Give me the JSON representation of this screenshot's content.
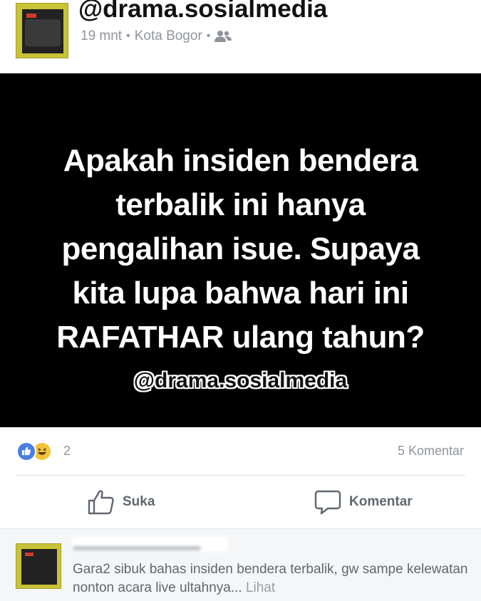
{
  "header": {
    "watermark": "@drama.sosialmedia",
    "time": "19 mnt",
    "location": "Kota Bogor",
    "separator": "•",
    "audience_icon": "friends-icon"
  },
  "post": {
    "lines": [
      "Apakah insiden bendera",
      "terbalik ini hanya",
      "pengalihan isue. Supaya",
      "kita lupa bahwa hari ini",
      "RAFATHAR ulang tahun?"
    ],
    "watermark": "@drama.sosialmedia",
    "background_color": "#000000"
  },
  "reactions": {
    "icons": [
      "like-reaction-icon",
      "haha-reaction-icon"
    ],
    "count": "2",
    "comments": "5 Komentar"
  },
  "actions": {
    "like_label": "Suka",
    "comment_label": "Komentar"
  },
  "comment": {
    "text": "Gara2 sibuk bahas insiden bendera terbalik, gw sampe kelewatan nonton acara live ultahnya...",
    "more": "Lihat"
  }
}
